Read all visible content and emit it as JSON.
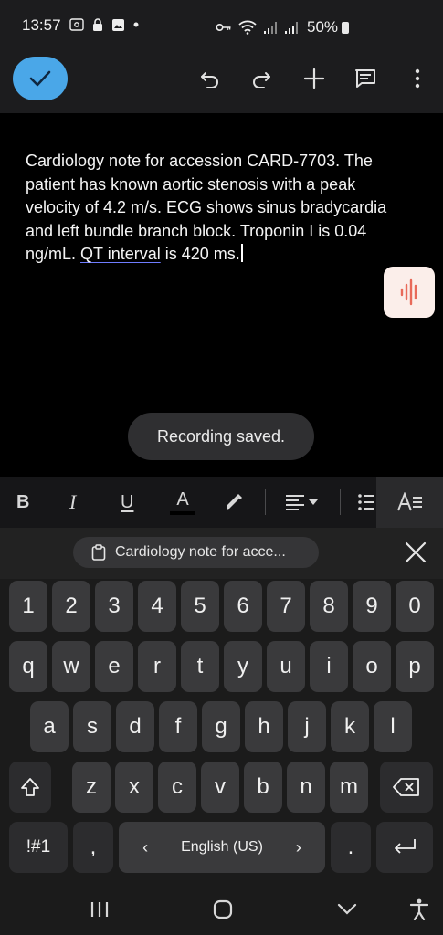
{
  "status_bar": {
    "time": "13:57",
    "battery": "50%",
    "left_icons": [
      "screenshot-icon",
      "lock-icon",
      "image-icon",
      "dot-icon"
    ],
    "right_icons": [
      "key-icon",
      "wifi-icon",
      "signal-icon",
      "signal-icon"
    ]
  },
  "toolbar": {
    "accent": "#4aa7e8",
    "icons": [
      "check-icon",
      "undo-icon",
      "redo-icon",
      "plus-icon",
      "comment-icon",
      "more-vert-icon"
    ]
  },
  "note": {
    "text_before": "Cardiology note for accession CARD-7703. The patient has known aortic stenosis with a peak velocity of 4.2 m/s. ECG shows sinus bradycardia and left bundle branch block. Troponin I is 0.04 ng/mL. ",
    "underlined": "QT interval",
    "text_after": " is 420 ms."
  },
  "toast": {
    "text": "Recording saved."
  },
  "format_bar": {
    "bold": "B",
    "italic": "I",
    "underline": "U",
    "text_color": "A"
  },
  "keyboard": {
    "clipboard_chip": "Cardiology note for acce...",
    "rows": {
      "numbers": [
        "1",
        "2",
        "3",
        "4",
        "5",
        "6",
        "7",
        "8",
        "9",
        "0"
      ],
      "row1": [
        "q",
        "w",
        "e",
        "r",
        "t",
        "y",
        "u",
        "i",
        "o",
        "p"
      ],
      "row2": [
        "a",
        "s",
        "d",
        "f",
        "g",
        "h",
        "j",
        "k",
        "l"
      ],
      "row3": [
        "z",
        "x",
        "c",
        "v",
        "b",
        "n",
        "m"
      ]
    },
    "symbols_key": "!#1",
    "comma_key": ",",
    "space_label": "English (US)",
    "space_left": "‹",
    "space_right": "›",
    "period_key": "."
  }
}
